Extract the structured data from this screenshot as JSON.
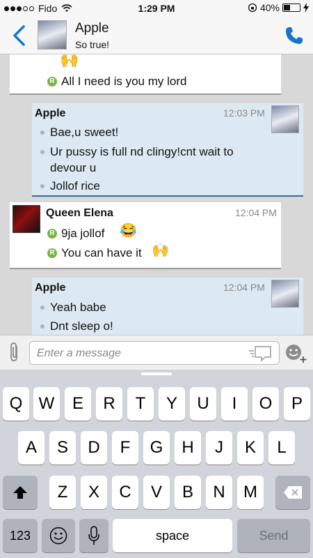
{
  "status_bar": {
    "carrier": "Fido",
    "time": "1:29 PM",
    "battery": "40%",
    "battery_level": 0.4
  },
  "header": {
    "contact_name": "Apple",
    "contact_status": "So true!",
    "back_icon": "chevron-left-icon",
    "call_icon": "phone-icon"
  },
  "messages": [
    {
      "sender": "",
      "time": "",
      "mine": false,
      "lines": [
        {
          "text": "🙌",
          "marker": "none"
        },
        {
          "text": "All I need is you my lord",
          "marker": "r"
        }
      ]
    },
    {
      "sender": "Apple",
      "time": "12:03 PM",
      "mine": true,
      "lines": [
        {
          "text": "Bae,u sweet!",
          "marker": "bullet"
        },
        {
          "text": "Ur pussy is full nd clingy!cnt wait to",
          "marker": "bullet"
        },
        {
          "text": "devour u",
          "marker": "none"
        },
        {
          "text": "Jollof rice",
          "marker": "bullet"
        }
      ]
    },
    {
      "sender": "Queen Elena",
      "time": "12:04 PM",
      "mine": false,
      "lines": [
        {
          "text": "9ja jollof",
          "emoji": "😂",
          "marker": "r"
        },
        {
          "text": "You can have it",
          "emoji": "🙌",
          "marker": "r"
        }
      ]
    },
    {
      "sender": "Apple",
      "time": "12:04 PM",
      "mine": true,
      "lines": [
        {
          "text": "Yeah babe",
          "marker": "bullet"
        },
        {
          "text": "Dnt sleep o!",
          "marker": "bullet"
        }
      ]
    }
  ],
  "composer": {
    "placeholder": "Enter a message"
  },
  "keyboard": {
    "row1": [
      "Q",
      "W",
      "E",
      "R",
      "T",
      "Y",
      "U",
      "I",
      "O",
      "P"
    ],
    "row2": [
      "A",
      "S",
      "D",
      "F",
      "G",
      "H",
      "J",
      "K",
      "L"
    ],
    "row3": [
      "Z",
      "X",
      "C",
      "V",
      "B",
      "N",
      "M"
    ],
    "numbers_key": "123",
    "space_key": "space",
    "send_key": "Send"
  },
  "colors": {
    "accent": "#1a73c8",
    "own_bubble": "#dde9f2",
    "own_underline": "#2f6e98",
    "read_icon": "#7cb342"
  }
}
